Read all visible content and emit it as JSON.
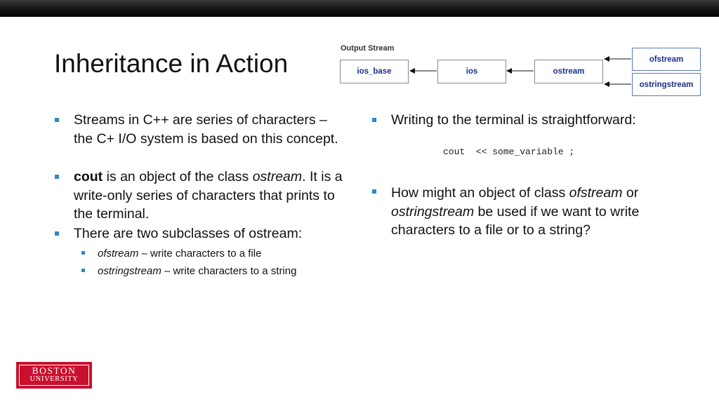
{
  "title": "Inheritance in Action",
  "diagram": {
    "title": "Output Stream",
    "nodes": [
      "ios_base",
      "ios",
      "ostream",
      "ofstream",
      "ostringstream"
    ]
  },
  "left_column": {
    "bullet1": "Streams in C++ are series of characters – the C+ I/O system is based on this concept.",
    "bullet2_bold": "cout",
    "bullet2_mid": " is an object of the class ",
    "bullet2_italic": "ostream",
    "bullet2_end": ". It is a write-only series of characters that prints to the terminal.",
    "bullet3": "There are two subclasses of ostream:",
    "sub1_italic": "ofstream",
    "sub1_text": " – write characters to a file",
    "sub2_italic": "ostringstream",
    "sub2_text": " – write characters to a string"
  },
  "right_column": {
    "bullet1": "Writing to the terminal is straightforward:",
    "code": "cout  << some_variable ;",
    "bullet2_a": "How might an object of class ",
    "bullet2_italic1": "ofstream",
    "bullet2_b": " or ",
    "bullet2_italic2": "ostringstream",
    "bullet2_c": " be used if we want to write characters to a file or to a string?"
  },
  "logo": {
    "line1": "BOSTON",
    "line2": "UNIVERSITY"
  },
  "colors": {
    "bullet": "#2e88c8",
    "diagram_text": "#1e2e8a",
    "logo": "#c8102e"
  }
}
